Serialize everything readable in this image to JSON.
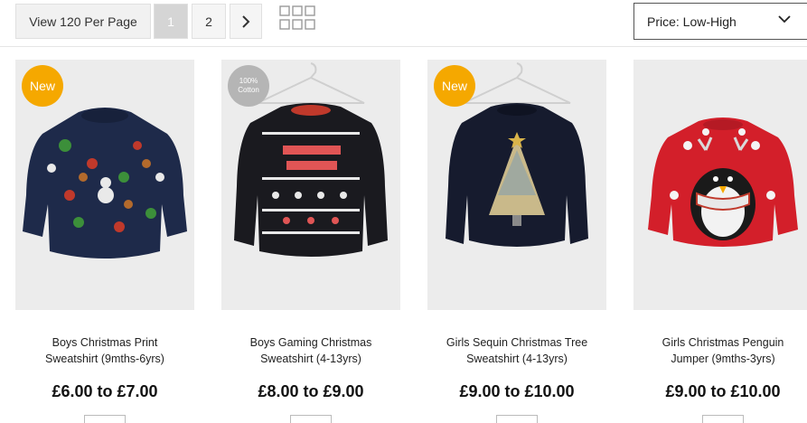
{
  "toolbar": {
    "per_page_label": "View 120 Per Page",
    "pages": [
      "1",
      "2"
    ],
    "current_page": "1",
    "sort": {
      "selected": "Price: Low-High"
    }
  },
  "products": [
    {
      "badge": "New",
      "title_line1": "Boys Christmas Print",
      "title_line2": "Sweatshirt (9mths-6yrs)",
      "price": "£6.00 to £7.00",
      "color": "#1e2a4a"
    },
    {
      "badge_line1": "100%",
      "badge_line2": "Cotton",
      "title_line1": "Boys Gaming Christmas",
      "title_line2": "Sweatshirt (4-13yrs)",
      "price": "£8.00 to £9.00",
      "color": "#1a1a1f"
    },
    {
      "badge": "New",
      "title_line1": "Girls Sequin Christmas Tree",
      "title_line2": "Sweatshirt (4-13yrs)",
      "price": "£9.00 to £10.00",
      "color": "#161b2e"
    },
    {
      "title_line1": "Girls Christmas Penguin",
      "title_line2": "Jumper (9mths-3yrs)",
      "price": "£9.00 to £10.00",
      "color": "#d31f2a"
    }
  ],
  "colors": {
    "badge_new": "#f5a800",
    "badge_cotton": "#b5b5b5",
    "image_bg": "#ececec"
  }
}
